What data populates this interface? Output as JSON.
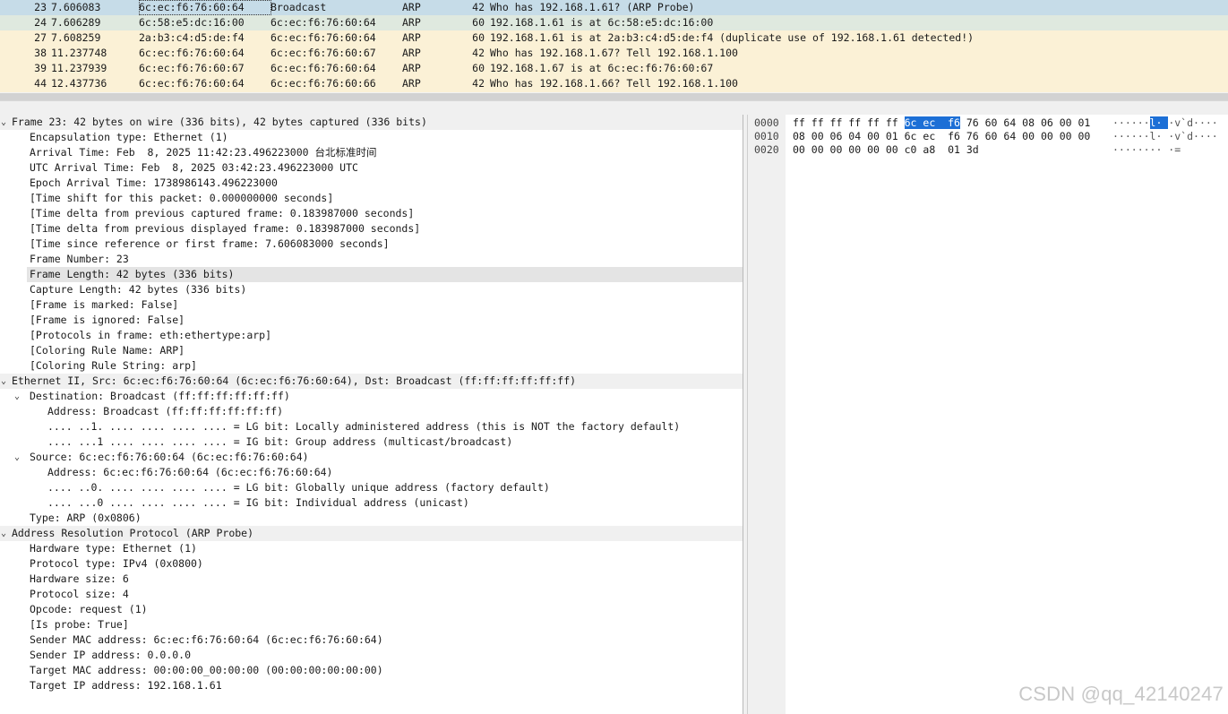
{
  "packets": [
    {
      "no": "23",
      "time": "7.606083",
      "src": "6c:ec:f6:76:60:64",
      "dst": "Broadcast",
      "proto": "ARP",
      "len": "42",
      "info": "Who has 192.168.1.61? (ARP Probe)"
    },
    {
      "no": "24",
      "time": "7.606289",
      "src": "6c:58:e5:dc:16:00",
      "dst": "6c:ec:f6:76:60:64",
      "proto": "ARP",
      "len": "60",
      "info": "192.168.1.61 is at 6c:58:e5:dc:16:00"
    },
    {
      "no": "27",
      "time": "7.608259",
      "src": "2a:b3:c4:d5:de:f4",
      "dst": "6c:ec:f6:76:60:64",
      "proto": "ARP",
      "len": "60",
      "info": "192.168.1.61 is at 2a:b3:c4:d5:de:f4 (duplicate use of 192.168.1.61 detected!)"
    },
    {
      "no": "38",
      "time": "11.237748",
      "src": "6c:ec:f6:76:60:64",
      "dst": "6c:ec:f6:76:60:67",
      "proto": "ARP",
      "len": "42",
      "info": "Who has 192.168.1.67? Tell 192.168.1.100"
    },
    {
      "no": "39",
      "time": "11.237939",
      "src": "6c:ec:f6:76:60:67",
      "dst": "6c:ec:f6:76:60:64",
      "proto": "ARP",
      "len": "60",
      "info": "192.168.1.67 is at 6c:ec:f6:76:60:67"
    },
    {
      "no": "44",
      "time": "12.437736",
      "src": "6c:ec:f6:76:60:64",
      "dst": "6c:ec:f6:76:60:66",
      "proto": "ARP",
      "len": "42",
      "info": "Who has 192.168.1.66? Tell 192.168.1.100"
    }
  ],
  "details": {
    "expand_open": "⌄",
    "frame": {
      "header": "Frame 23: 42 bytes on wire (336 bits), 42 bytes captured (336 bits)",
      "lines": [
        "Encapsulation type: Ethernet (1)",
        "Arrival Time: Feb  8, 2025 11:42:23.496223000 台北标准时间",
        "UTC Arrival Time: Feb  8, 2025 03:42:23.496223000 UTC",
        "Epoch Arrival Time: 1738986143.496223000",
        "[Time shift for this packet: 0.000000000 seconds]",
        "[Time delta from previous captured frame: 0.183987000 seconds]",
        "[Time delta from previous displayed frame: 0.183987000 seconds]",
        "[Time since reference or first frame: 7.606083000 seconds]",
        "Frame Number: 23",
        "Frame Length: 42 bytes (336 bits)",
        "Capture Length: 42 bytes (336 bits)",
        "[Frame is marked: False]",
        "[Frame is ignored: False]",
        "[Protocols in frame: eth:ethertype:arp]",
        "[Coloring Rule Name: ARP]",
        "[Coloring Rule String: arp]"
      ]
    },
    "ethernet": {
      "header": "Ethernet II, Src: 6c:ec:f6:76:60:64 (6c:ec:f6:76:60:64), Dst: Broadcast (ff:ff:ff:ff:ff:ff)",
      "destination": "Destination: Broadcast (ff:ff:ff:ff:ff:ff)",
      "dst_lines": [
        "Address: Broadcast (ff:ff:ff:ff:ff:ff)",
        ".... ..1. .... .... .... .... = LG bit: Locally administered address (this is NOT the factory default)",
        ".... ...1 .... .... .... .... = IG bit: Group address (multicast/broadcast)"
      ],
      "source": "Source: 6c:ec:f6:76:60:64 (6c:ec:f6:76:60:64)",
      "src_lines": [
        "Address: 6c:ec:f6:76:60:64 (6c:ec:f6:76:60:64)",
        ".... ..0. .... .... .... .... = LG bit: Globally unique address (factory default)",
        ".... ...0 .... .... .... .... = IG bit: Individual address (unicast)"
      ],
      "type": "Type: ARP (0x0806)"
    },
    "arp": {
      "header": "Address Resolution Protocol (ARP Probe)",
      "lines": [
        "Hardware type: Ethernet (1)",
        "Protocol type: IPv4 (0x0800)",
        "Hardware size: 6",
        "Protocol size: 4",
        "Opcode: request (1)",
        "[Is probe: True]",
        "Sender MAC address: 6c:ec:f6:76:60:64 (6c:ec:f6:76:60:64)",
        "Sender IP address: 0.0.0.0",
        "Target MAC address: 00:00:00_00:00:00 (00:00:00:00:00:00)",
        "Target IP address: 192.168.1.61"
      ]
    }
  },
  "bytes": [
    {
      "offset": "0000",
      "hex_pre": "ff ff ff ff ff ff ",
      "hex_hl": "6c ec  f6",
      "hex_post": " 76 60 64 08 06 00 01",
      "ascii_pre": "······",
      "ascii_hl": "l· ",
      "ascii_post": "·v`d····"
    },
    {
      "offset": "0010",
      "hex_pre": "08 00 06 04 00 01 6c ec  f6 76 60 64 00 00 00 00",
      "hex_hl": "",
      "hex_post": "",
      "ascii_pre": "······l· ·v`d····",
      "ascii_hl": "",
      "ascii_post": ""
    },
    {
      "offset": "0020",
      "hex_pre": "00 00 00 00 00 00 c0 a8  01 3d",
      "hex_hl": "",
      "hex_post": "",
      "ascii_pre": "········ ·=",
      "ascii_hl": "",
      "ascii_post": ""
    }
  ],
  "watermark": "CSDN @qq_42140247"
}
